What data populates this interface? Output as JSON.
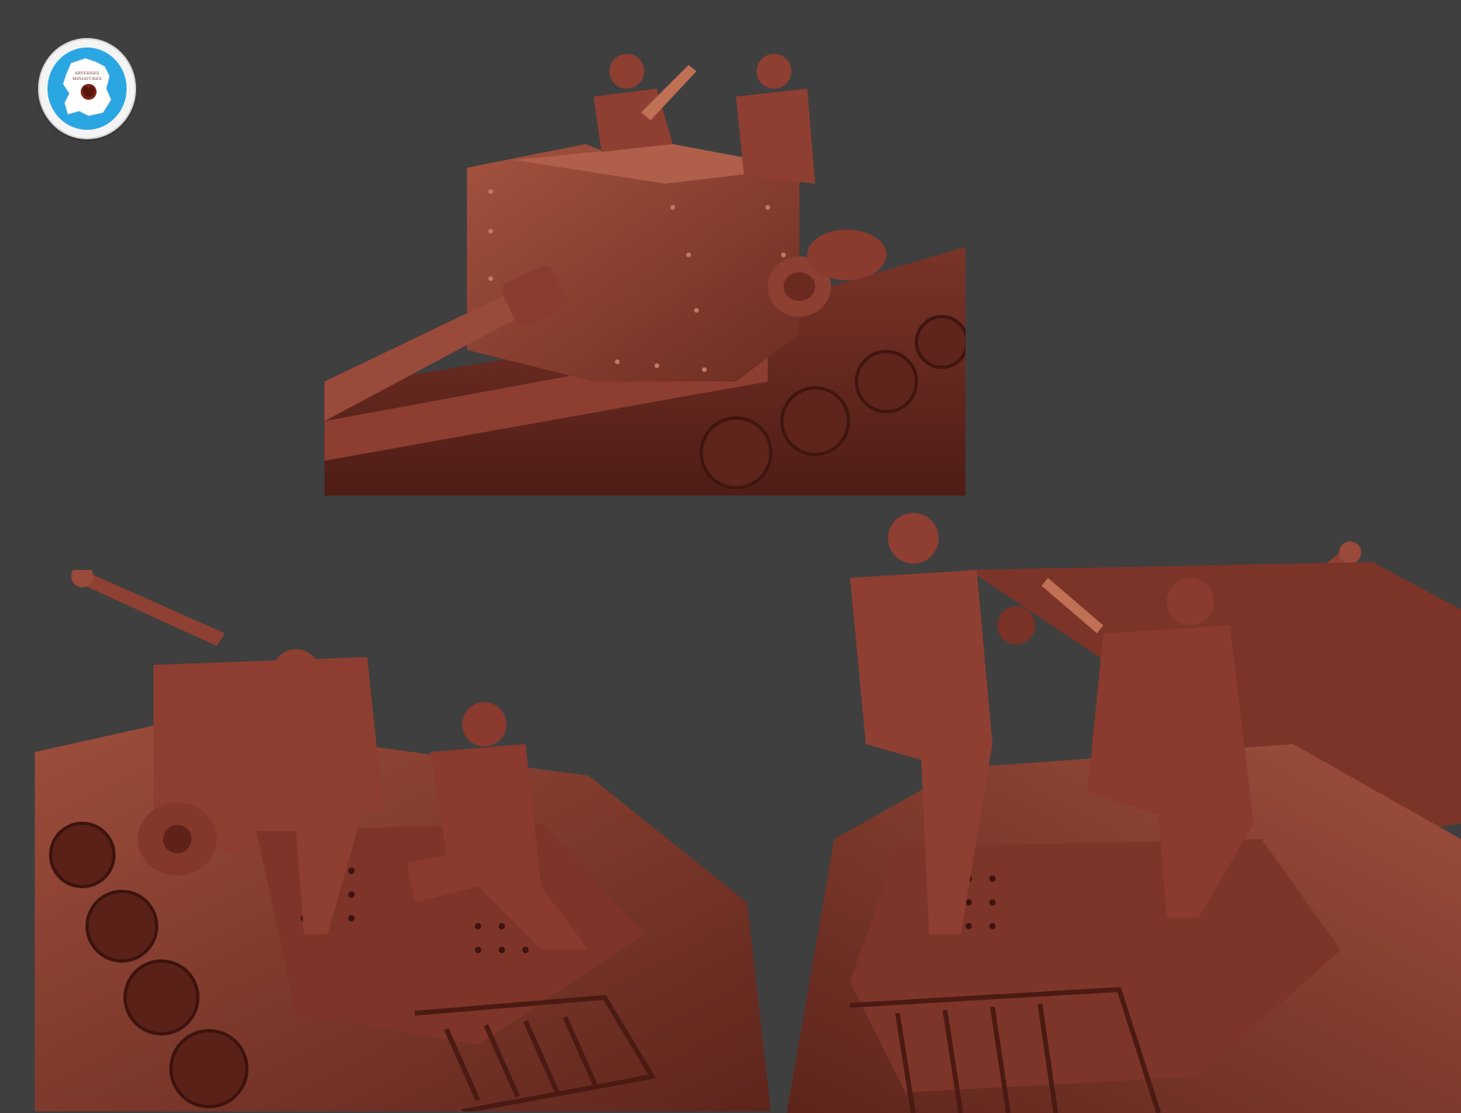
{
  "scene": {
    "background_color": "#3f3f3f",
    "model_color": "#8a3c30"
  },
  "logo": {
    "icon": "france-map-boar-badge-icon",
    "line1": "ARVERNES",
    "line2": "MINIATURES"
  },
  "views": [
    {
      "name": "front-three-quarter",
      "icon": "tank-destroyer-render"
    },
    {
      "name": "rear-left",
      "icon": "tank-destroyer-render"
    },
    {
      "name": "rear-right",
      "icon": "tank-destroyer-render"
    }
  ]
}
